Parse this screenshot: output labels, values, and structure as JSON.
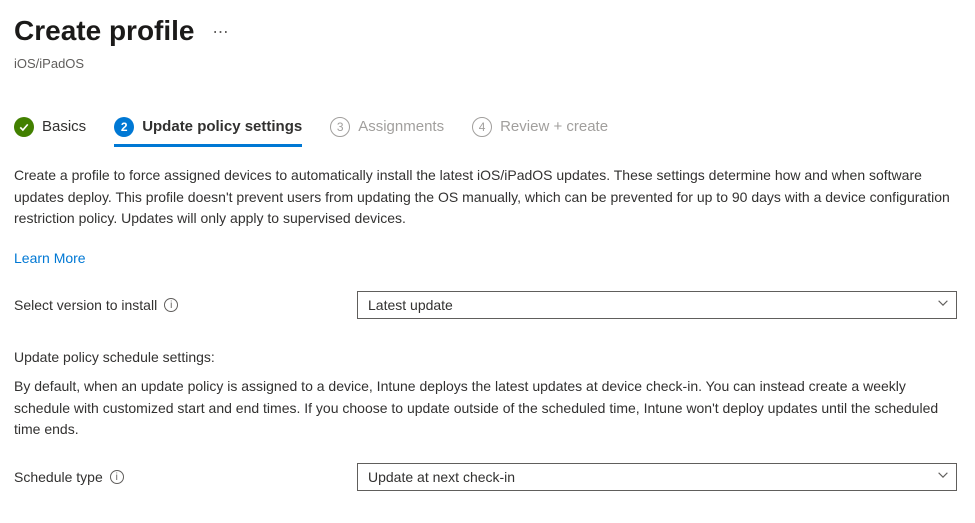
{
  "header": {
    "title": "Create profile",
    "subtitle": "iOS/iPadOS"
  },
  "tabs": {
    "basics": "Basics",
    "update_policy_num": "2",
    "update_policy": "Update policy settings",
    "assignments_num": "3",
    "assignments": "Assignments",
    "review_num": "4",
    "review": "Review + create"
  },
  "body": {
    "description": "Create a profile to force assigned devices to automatically install the latest iOS/iPadOS updates. These settings determine how and when software updates deploy. This profile doesn't prevent users from updating the OS manually, which can be prevented for up to 90 days with a device configuration restriction policy. Updates will only apply to supervised devices.",
    "learn_more": "Learn More"
  },
  "form": {
    "version_label": "Select version to install",
    "version_value": "Latest update",
    "schedule_heading": "Update policy schedule settings:",
    "schedule_desc": "By default, when an update policy is assigned to a device, Intune deploys the latest updates at device check-in. You can instead create a weekly schedule with customized start and end times. If you choose to update outside of the scheduled time, Intune won't deploy updates until the scheduled time ends.",
    "schedule_type_label": "Schedule type",
    "schedule_type_value": "Update at next check-in"
  }
}
